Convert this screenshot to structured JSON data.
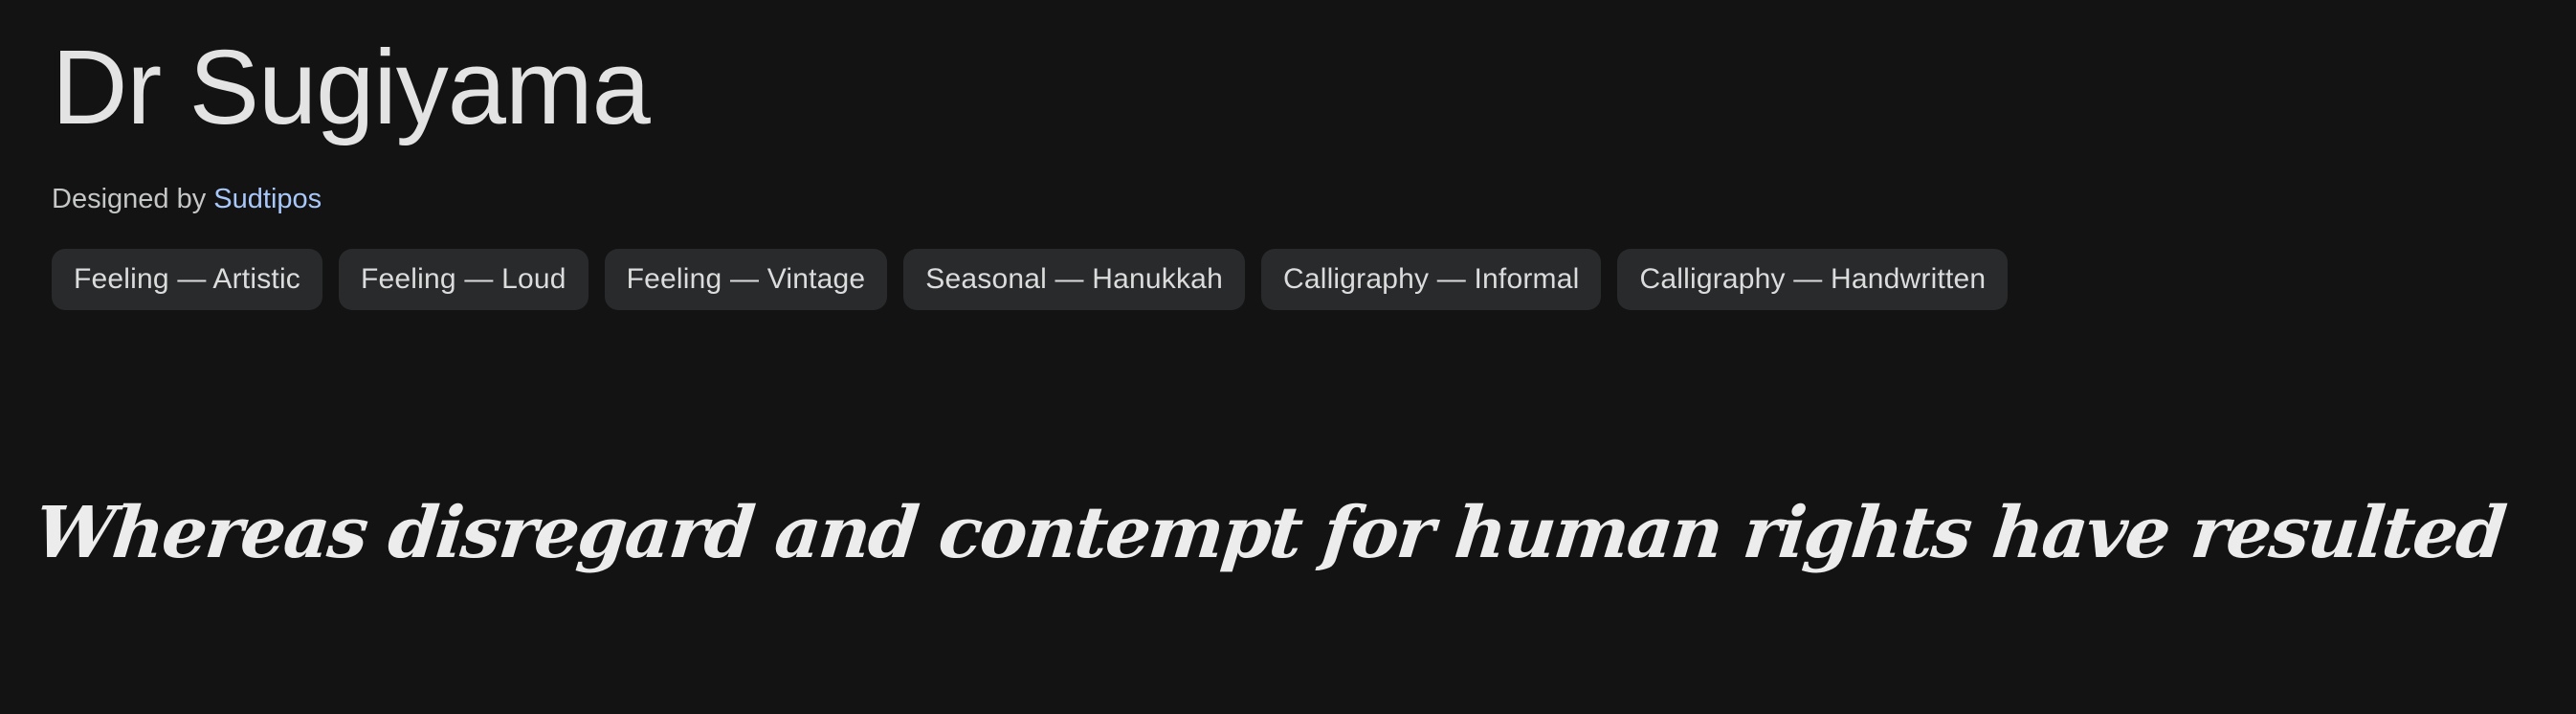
{
  "font": {
    "name": "Dr Sugiyama",
    "designed_by_label": "Designed by",
    "designer": "Sudtipos"
  },
  "tags": [
    {
      "label": "Feeling — Artistic"
    },
    {
      "label": "Feeling — Loud"
    },
    {
      "label": "Feeling — Vintage"
    },
    {
      "label": "Seasonal — Hanukkah"
    },
    {
      "label": "Calligraphy — Informal"
    },
    {
      "label": "Calligraphy — Handwritten"
    }
  ],
  "specimen": {
    "text": "Whereas disregard and contempt for human rights have resulted"
  },
  "colors": {
    "background": "#131313",
    "title": "#e3e3e3",
    "designer_link": "#a8c7fa",
    "tag_background": "#282a2c"
  }
}
